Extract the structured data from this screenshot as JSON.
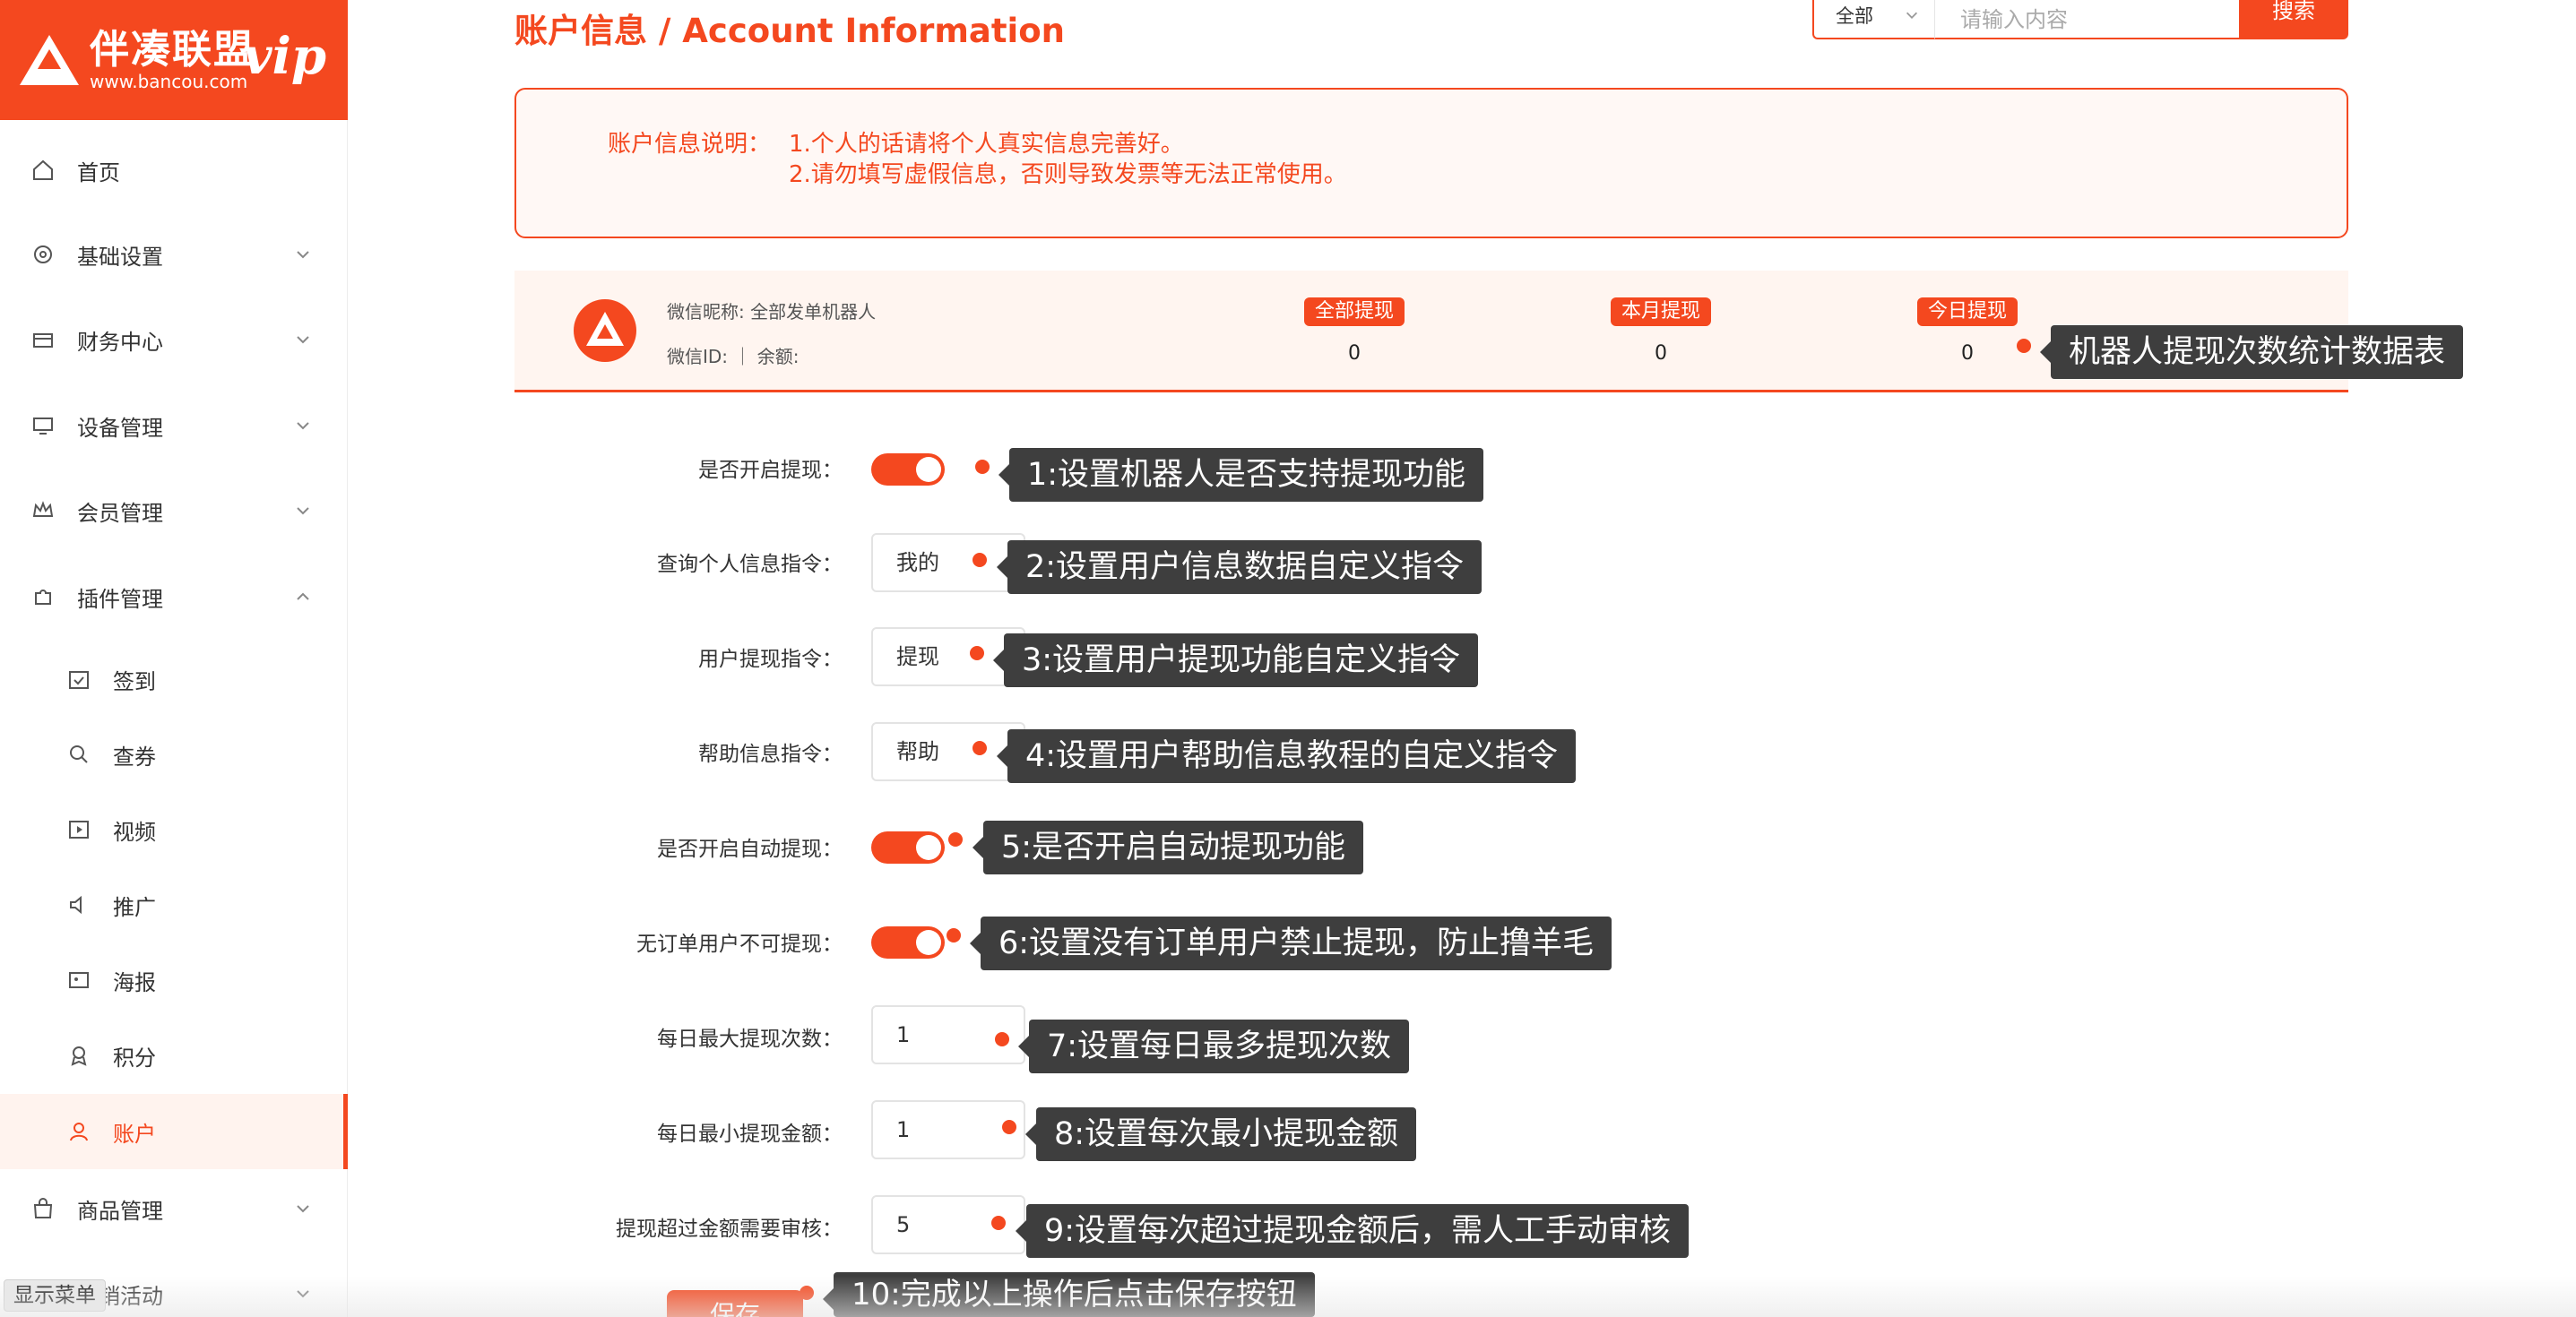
{
  "logo": {
    "name": "伴凑联盟",
    "url": "www.bancou.com",
    "vip": "vip"
  },
  "sidebar": {
    "items": [
      {
        "label": "首页",
        "icon": "home-icon"
      },
      {
        "label": "基础设置",
        "icon": "gear-icon"
      },
      {
        "label": "财务中心",
        "icon": "finance-icon"
      },
      {
        "label": "设备管理",
        "icon": "monitor-icon"
      },
      {
        "label": "会员管理",
        "icon": "crown-icon"
      },
      {
        "label": "插件管理",
        "icon": "puzzle-icon"
      },
      {
        "label": "签到",
        "icon": "calendar-check-icon"
      },
      {
        "label": "查券",
        "icon": "search-icon"
      },
      {
        "label": "视频",
        "icon": "video-icon"
      },
      {
        "label": "推广",
        "icon": "speaker-icon"
      },
      {
        "label": "海报",
        "icon": "poster-icon"
      },
      {
        "label": "积分",
        "icon": "medal-icon"
      },
      {
        "label": "账户",
        "icon": "user-icon"
      },
      {
        "label": "商品管理",
        "icon": "bag-icon"
      },
      {
        "label": "营销活动",
        "icon": "gift-icon"
      }
    ],
    "show_menu": "显示菜单"
  },
  "header": {
    "title": "账户信息 / Account Information",
    "search": {
      "select_value": "全部",
      "placeholder": "请输入内容",
      "button": "搜索"
    }
  },
  "notice": {
    "label": "账户信息说明：",
    "line1": "1.个人的话请将个人真实信息完善好。",
    "line2": "2.请勿填写虚假信息，否则导致发票等无法正常使用。"
  },
  "stats": {
    "nickname": "微信昵称: 全部发单机器人",
    "wxid": "微信ID:     ｜ 余额:",
    "cols": [
      {
        "label": "全部提现",
        "value": "0"
      },
      {
        "label": "本月提现",
        "value": "0"
      },
      {
        "label": "今日提现",
        "value": "0"
      }
    ],
    "tip": "机器人提现次数统计数据表"
  },
  "form": {
    "rows": [
      {
        "label": "是否开启提现：",
        "type": "toggle",
        "on": true,
        "tip": "1:设置机器人是否支持提现功能"
      },
      {
        "label": "查询个人信息指令：",
        "type": "input",
        "value": "我的",
        "tip": "2:设置用户信息数据自定义指令"
      },
      {
        "label": "用户提现指令：",
        "type": "input",
        "value": "提现",
        "tip": "3:设置用户提现功能自定义指令"
      },
      {
        "label": "帮助信息指令：",
        "type": "input",
        "value": "帮助",
        "tip": "4:设置用户帮助信息教程的自定义指令"
      },
      {
        "label": "是否开启自动提现：",
        "type": "toggle",
        "on": true,
        "tip": "5:是否开启自动提现功能"
      },
      {
        "label": "无订单用户不可提现：",
        "type": "toggle",
        "on": true,
        "tip": "6:设置没有订单用户禁止提现，防止撸羊毛"
      },
      {
        "label": "每日最大提现次数：",
        "type": "input",
        "value": "1",
        "tip": "7:设置每日最多提现次数"
      },
      {
        "label": "每日最小提现金额：",
        "type": "input",
        "value": "1",
        "tip": "8:设置每次最小提现金额"
      },
      {
        "label": "提现超过金额需要审核：",
        "type": "input",
        "value": "5",
        "tip": "9:设置每次超过提现金额后，需人工手动审核"
      }
    ],
    "save": "保存",
    "save_tip": "10:完成以上操作后点击保存按钮"
  },
  "colors": {
    "accent": "#f4481f",
    "tip_bg": "#3e3e3e"
  }
}
